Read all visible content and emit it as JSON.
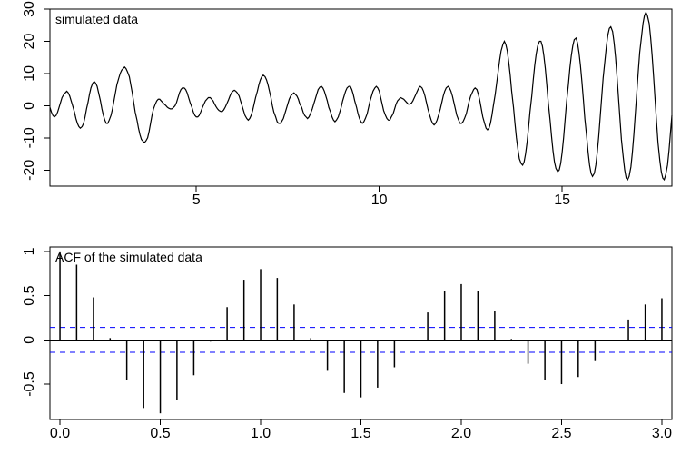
{
  "chart_data": [
    {
      "type": "line",
      "title": "simulated data",
      "xlabel": "",
      "ylabel": "",
      "xlim": [
        1,
        18
      ],
      "ylim": [
        -25,
        30
      ],
      "xticks": [
        5,
        10,
        15
      ],
      "yticks": [
        -20,
        -10,
        0,
        10,
        20,
        30
      ],
      "x": [
        1.0,
        1.04,
        1.08,
        1.12,
        1.17,
        1.21,
        1.25,
        1.29,
        1.33,
        1.38,
        1.42,
        1.46,
        1.5,
        1.54,
        1.58,
        1.62,
        1.67,
        1.71,
        1.75,
        1.79,
        1.83,
        1.88,
        1.92,
        1.96,
        2.0,
        2.04,
        2.08,
        2.12,
        2.17,
        2.21,
        2.25,
        2.29,
        2.33,
        2.38,
        2.42,
        2.46,
        2.5,
        2.54,
        2.58,
        2.62,
        2.67,
        2.71,
        2.75,
        2.79,
        2.83,
        2.88,
        2.92,
        2.96,
        3.0,
        3.04,
        3.08,
        3.12,
        3.17,
        3.21,
        3.25,
        3.29,
        3.33,
        3.38,
        3.42,
        3.46,
        3.5,
        3.54,
        3.58,
        3.62,
        3.67,
        3.71,
        3.75,
        3.79,
        3.83,
        3.88,
        3.92,
        3.96,
        4.0,
        4.04,
        4.08,
        4.12,
        4.17,
        4.21,
        4.25,
        4.29,
        4.33,
        4.38,
        4.42,
        4.46,
        4.5,
        4.54,
        4.58,
        4.62,
        4.67,
        4.71,
        4.75,
        4.79,
        4.83,
        4.88,
        4.92,
        4.96,
        5.0,
        5.04,
        5.08,
        5.12,
        5.17,
        5.21,
        5.25,
        5.29,
        5.33,
        5.38,
        5.42,
        5.46,
        5.5,
        5.54,
        5.58,
        5.62,
        5.67,
        5.71,
        5.75,
        5.79,
        5.83,
        5.88,
        5.92,
        5.96,
        6.0,
        6.04,
        6.08,
        6.12,
        6.17,
        6.21,
        6.25,
        6.29,
        6.33,
        6.38,
        6.42,
        6.46,
        6.5,
        6.54,
        6.58,
        6.62,
        6.67,
        6.71,
        6.75,
        6.79,
        6.83,
        6.88,
        6.92,
        6.96,
        7.0,
        7.04,
        7.08,
        7.12,
        7.17,
        7.21,
        7.25,
        7.29,
        7.33,
        7.38,
        7.42,
        7.46,
        7.5,
        7.54,
        7.58,
        7.62,
        7.67,
        7.71,
        7.75,
        7.79,
        7.83,
        7.88,
        7.92,
        7.96,
        8.0,
        8.04,
        8.08,
        8.12,
        8.17,
        8.21,
        8.25,
        8.29,
        8.33,
        8.38,
        8.42,
        8.46,
        8.5,
        8.54,
        8.58,
        8.62,
        8.67,
        8.71,
        8.75,
        8.79,
        8.83,
        8.88,
        8.92,
        8.96,
        9.0,
        9.04,
        9.08,
        9.12,
        9.17,
        9.21,
        9.25,
        9.29,
        9.33,
        9.38,
        9.42,
        9.46,
        9.5,
        9.54,
        9.58,
        9.62,
        9.67,
        9.71,
        9.75,
        9.79,
        9.83,
        9.88,
        9.92,
        9.96,
        10.0,
        10.04,
        10.08,
        10.12,
        10.17,
        10.21,
        10.25,
        10.29,
        10.33,
        10.38,
        10.42,
        10.46,
        10.5,
        10.54,
        10.58,
        10.62,
        10.67,
        10.71,
        10.75,
        10.79,
        10.83,
        10.88,
        10.92,
        10.96,
        11.0,
        11.04,
        11.08,
        11.12,
        11.17,
        11.21,
        11.25,
        11.29,
        11.33,
        11.38,
        11.42,
        11.46,
        11.5,
        11.54,
        11.58,
        11.62,
        11.67,
        11.71,
        11.75,
        11.79,
        11.83,
        11.88,
        11.92,
        11.96,
        12.0,
        12.04,
        12.08,
        12.12,
        12.17,
        12.21,
        12.25,
        12.29,
        12.33,
        12.38,
        12.42,
        12.46,
        12.5,
        12.54,
        12.58,
        12.62,
        12.67,
        12.71,
        12.75,
        12.79,
        12.83,
        12.88,
        12.92,
        12.96,
        13.0,
        13.04,
        13.08,
        13.12,
        13.17,
        13.21,
        13.25,
        13.29,
        13.33,
        13.38,
        13.42,
        13.46,
        13.5,
        13.54,
        13.58,
        13.62,
        13.67,
        13.71,
        13.75,
        13.79,
        13.83,
        13.88,
        13.92,
        13.96,
        14.0,
        14.04,
        14.08,
        14.12,
        14.17,
        14.21,
        14.25,
        14.29,
        14.33,
        14.38,
        14.42,
        14.46,
        14.5,
        14.54,
        14.58,
        14.62,
        14.67,
        14.71,
        14.75,
        14.79,
        14.83,
        14.88,
        14.92,
        14.96,
        15.0,
        15.04,
        15.08,
        15.12,
        15.17,
        15.21,
        15.25,
        15.29,
        15.33,
        15.38,
        15.42,
        15.46,
        15.5,
        15.54,
        15.58,
        15.62,
        15.67,
        15.71,
        15.75,
        15.79,
        15.83,
        15.88,
        15.92,
        15.96,
        16.0,
        16.04,
        16.08,
        16.12,
        16.17,
        16.21,
        16.25,
        16.29,
        16.33,
        16.38,
        16.42,
        16.46,
        16.5,
        16.54,
        16.58,
        16.62,
        16.67,
        16.71,
        16.75,
        16.79,
        16.83,
        16.88,
        16.92,
        16.96,
        17.0,
        17.04,
        17.08,
        17.12,
        17.17,
        17.21,
        17.25,
        17.29,
        17.33,
        17.38,
        17.42,
        17.46,
        17.5,
        17.54,
        17.58,
        17.62,
        17.67,
        17.71,
        17.75,
        17.79,
        17.83,
        17.88,
        17.92,
        17.96,
        18.0
      ],
      "values": [
        -0.5,
        -2.0,
        -3.0,
        -3.5,
        -3.0,
        -2.0,
        -0.5,
        1.0,
        2.5,
        3.5,
        4.0,
        4.5,
        4.0,
        3.0,
        1.5,
        0.0,
        -2.0,
        -4.0,
        -5.5,
        -6.5,
        -7.0,
        -6.5,
        -5.5,
        -3.5,
        -1.0,
        1.0,
        3.5,
        5.5,
        7.0,
        7.5,
        7.0,
        6.0,
        4.0,
        1.5,
        -1.0,
        -3.0,
        -4.5,
        -5.5,
        -5.5,
        -4.5,
        -3.0,
        -1.0,
        1.5,
        4.0,
        6.5,
        8.5,
        10.0,
        11.0,
        11.5,
        12.0,
        11.5,
        10.5,
        9.0,
        6.5,
        4.0,
        1.0,
        -2.0,
        -4.5,
        -7.0,
        -9.0,
        -10.5,
        -11.0,
        -11.5,
        -11.0,
        -10.0,
        -8.0,
        -5.5,
        -3.0,
        -1.0,
        0.5,
        1.5,
        2.0,
        2.0,
        1.5,
        1.0,
        0.5,
        0.0,
        -0.5,
        -0.8,
        -1.0,
        -1.0,
        -0.5,
        0.0,
        1.0,
        2.5,
        4.0,
        5.0,
        5.5,
        5.5,
        5.0,
        4.0,
        2.5,
        1.0,
        -0.5,
        -2.0,
        -3.0,
        -3.5,
        -3.5,
        -3.0,
        -2.0,
        -0.5,
        0.5,
        1.5,
        2.0,
        2.5,
        2.5,
        2.0,
        1.5,
        0.5,
        -0.3,
        -1.0,
        -1.5,
        -1.8,
        -1.8,
        -1.3,
        -0.5,
        0.5,
        1.8,
        3.0,
        4.0,
        4.5,
        4.8,
        4.5,
        4.0,
        3.0,
        1.5,
        0.0,
        -1.5,
        -3.0,
        -4.0,
        -4.5,
        -4.0,
        -3.0,
        -1.5,
        0.5,
        2.5,
        4.5,
        6.5,
        8.0,
        9.0,
        9.5,
        9.0,
        8.0,
        6.5,
        4.5,
        2.5,
        0.0,
        -2.0,
        -3.5,
        -5.0,
        -5.5,
        -5.5,
        -5.0,
        -4.0,
        -2.5,
        -1.0,
        0.5,
        2.0,
        3.0,
        3.5,
        4.0,
        3.5,
        3.0,
        2.0,
        0.5,
        -0.5,
        -2.0,
        -3.0,
        -3.5,
        -4.0,
        -3.5,
        -2.5,
        -1.0,
        0.5,
        2.0,
        3.5,
        5.0,
        5.8,
        6.0,
        5.5,
        4.5,
        3.0,
        1.5,
        -0.5,
        -2.0,
        -3.5,
        -4.5,
        -5.0,
        -4.5,
        -3.5,
        -2.0,
        -0.5,
        1.5,
        3.0,
        4.5,
        5.5,
        6.0,
        6.0,
        5.0,
        3.5,
        1.5,
        -0.5,
        -2.5,
        -4.0,
        -5.0,
        -5.5,
        -5.0,
        -4.0,
        -2.5,
        -0.5,
        1.5,
        3.0,
        4.5,
        5.5,
        6.0,
        5.5,
        4.5,
        2.5,
        0.5,
        -1.5,
        -3.0,
        -4.0,
        -4.5,
        -4.5,
        -3.5,
        -2.5,
        -1.0,
        0.5,
        1.5,
        2.0,
        2.5,
        2.3,
        2.0,
        1.5,
        1.0,
        0.5,
        0.5,
        0.8,
        1.5,
        2.5,
        3.5,
        4.5,
        5.5,
        6.0,
        5.5,
        4.5,
        3.0,
        1.0,
        -1.0,
        -3.0,
        -4.5,
        -5.5,
        -6.0,
        -5.5,
        -4.5,
        -3.0,
        -1.0,
        1.0,
        3.0,
        4.5,
        5.5,
        6.0,
        5.5,
        4.5,
        3.0,
        1.0,
        -1.0,
        -3.0,
        -4.5,
        -5.5,
        -5.5,
        -5.0,
        -4.0,
        -2.5,
        -0.5,
        1.5,
        3.0,
        4.0,
        5.0,
        5.5,
        5.0,
        3.5,
        1.5,
        -1.0,
        -3.5,
        -5.5,
        -7.0,
        -7.5,
        -7.0,
        -5.5,
        -3.0,
        0.0,
        3.5,
        7.0,
        10.5,
        14.0,
        17.0,
        19.0,
        20.0,
        19.0,
        17.0,
        13.5,
        9.5,
        4.5,
        -0.5,
        -5.5,
        -10.0,
        -13.5,
        -16.5,
        -18.0,
        -18.5,
        -17.5,
        -15.0,
        -11.5,
        -7.0,
        -2.0,
        3.0,
        8.0,
        12.5,
        16.0,
        18.5,
        20.0,
        20.0,
        18.5,
        15.5,
        11.5,
        6.5,
        1.0,
        -4.5,
        -9.5,
        -14.0,
        -17.5,
        -19.5,
        -20.5,
        -20.0,
        -18.0,
        -14.5,
        -10.0,
        -4.5,
        1.0,
        6.5,
        11.5,
        15.5,
        18.5,
        20.5,
        21.0,
        19.5,
        16.5,
        12.5,
        7.5,
        2.0,
        -4.0,
        -9.5,
        -14.5,
        -18.5,
        -21.0,
        -22.0,
        -21.0,
        -18.5,
        -14.5,
        -9.5,
        -3.5,
        2.5,
        8.5,
        14.0,
        18.5,
        22.0,
        24.0,
        24.5,
        23.0,
        19.5,
        15.0,
        9.0,
        2.5,
        -4.0,
        -10.5,
        -16.0,
        -20.0,
        -22.5,
        -23.0,
        -22.0,
        -19.0,
        -14.5,
        -9.0,
        -2.5,
        4.0,
        10.5,
        16.5,
        21.5,
        25.5,
        28.0,
        29.0,
        28.0,
        25.5,
        21.0,
        15.5,
        9.0,
        2.0,
        -5.0,
        -11.5,
        -17.0,
        -20.5,
        -22.5,
        -23.0,
        -21.5,
        -18.5,
        -14.0,
        -8.5,
        -3.0
      ]
    },
    {
      "type": "bar",
      "title": "ACF of the simulated data",
      "xlabel": "",
      "ylabel": "",
      "xlim": [
        -0.05,
        3.05
      ],
      "ylim": [
        -0.9,
        1.05
      ],
      "xticks": [
        0.0,
        0.5,
        1.0,
        1.5,
        2.0,
        2.5,
        3.0
      ],
      "yticks": [
        -0.5,
        0.0,
        0.5,
        1.0
      ],
      "ci": 0.14,
      "categories": [
        0.0,
        0.083,
        0.167,
        0.25,
        0.333,
        0.417,
        0.5,
        0.583,
        0.667,
        0.75,
        0.833,
        0.917,
        1.0,
        1.083,
        1.167,
        1.25,
        1.333,
        1.417,
        1.5,
        1.583,
        1.667,
        1.75,
        1.833,
        1.917,
        2.0,
        2.083,
        2.167,
        2.25,
        2.333,
        2.417,
        2.5,
        2.583,
        2.667,
        2.75,
        2.833,
        2.917,
        3.0
      ],
      "values": [
        1.0,
        0.85,
        0.48,
        0.02,
        -0.45,
        -0.77,
        -0.83,
        -0.68,
        -0.4,
        -0.02,
        0.37,
        0.68,
        0.8,
        0.7,
        0.4,
        0.02,
        -0.35,
        -0.6,
        -0.65,
        -0.54,
        -0.31,
        -0.01,
        0.31,
        0.55,
        0.63,
        0.55,
        0.33,
        0.01,
        -0.27,
        -0.45,
        -0.5,
        -0.42,
        -0.24,
        -0.01,
        0.23,
        0.4,
        0.47
      ]
    }
  ]
}
